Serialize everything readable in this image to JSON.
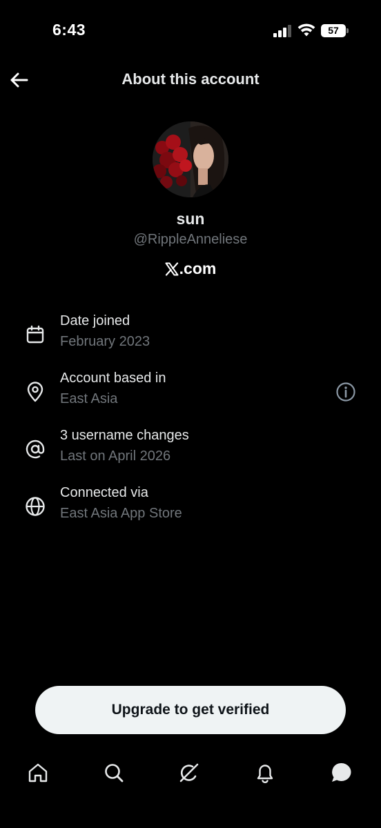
{
  "status_bar": {
    "time": "6:43",
    "battery": "57"
  },
  "header": {
    "title": "About this account"
  },
  "profile": {
    "display_name": "sun",
    "handle": "@RippleAnneliese",
    "site": ".com"
  },
  "info": [
    {
      "icon": "calendar-icon",
      "label": "Date joined",
      "value": "February 2023"
    },
    {
      "icon": "location-pin-icon",
      "label": "Account based in",
      "value": "East Asia"
    },
    {
      "icon": "at-sign-icon",
      "label": "3 username changes",
      "value": "Last on April 2026"
    },
    {
      "icon": "globe-icon",
      "label": "Connected via",
      "value": "East Asia App Store"
    }
  ],
  "upgrade": {
    "label": "Upgrade to get verified"
  },
  "nav": [
    "home-icon",
    "search-icon",
    "grok-icon",
    "notifications-icon",
    "messages-icon"
  ],
  "colors": {
    "background": "#000000",
    "primary_text": "#e7e9ea",
    "secondary_text": "#71767b",
    "button_bg": "#eff3f4"
  }
}
